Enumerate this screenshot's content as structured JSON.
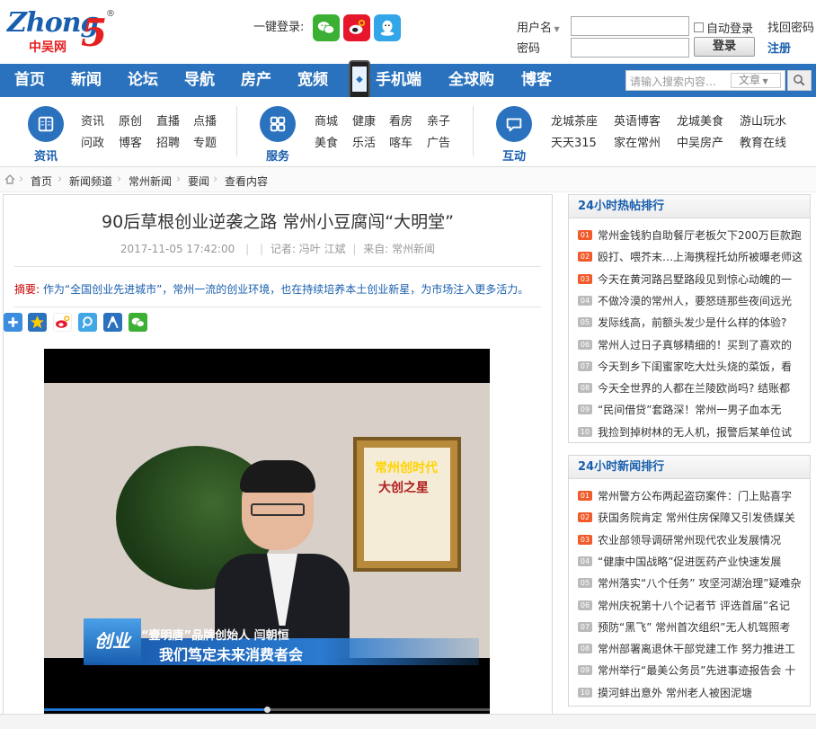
{
  "header": {
    "logo_letters": "Zhong",
    "logo_five": "5",
    "logo_cn": "中吴网",
    "logo_reg": "®",
    "quick_login_label": "一键登录:",
    "username_label": "用户名",
    "password_label": "密码",
    "auto_login_label": "自动登录",
    "login_button": "登录",
    "find_password": "找回密码",
    "register": "注册"
  },
  "nav": {
    "items": [
      "首页",
      "新闻",
      "论坛",
      "导航",
      "房产",
      "宽频",
      "手机端",
      "全球购",
      "博客"
    ],
    "search_placeholder": "请输入搜索内容…",
    "search_category": "文章"
  },
  "subnav": {
    "groups": [
      {
        "label": "资讯",
        "links": [
          "资讯",
          "原创",
          "直播",
          "点播",
          "问政",
          "博客",
          "招聘",
          "专题"
        ]
      },
      {
        "label": "服务",
        "links": [
          "商城",
          "健康",
          "看房",
          "亲子",
          "美食",
          "乐活",
          "喀车",
          "广告"
        ]
      },
      {
        "label": "互动",
        "links": [
          "龙城茶座",
          "英语博客",
          "龙城美食",
          "游山玩水",
          "天天315",
          "家在常州",
          "中吴房产",
          "教育在线"
        ]
      }
    ]
  },
  "breadcrumb": [
    "首页",
    "新闻频道",
    "常州新闻",
    "要闻",
    "查看内容"
  ],
  "article": {
    "title": "90后草根创业逆袭之路 常州小豆腐闯“大明堂”",
    "date": "2017-11-05 17:42:00",
    "reporter": "记者: 冯叶 江斌",
    "source": "来自: 常州新闻",
    "summary_label": "摘要:",
    "summary": " 作为“全国创业先进城市”，常州一流的创业环境，也在持续培养本土创业新星，为市场注入更多活力。"
  },
  "video": {
    "channel_logo": "常州创时代",
    "certificate_text": "大创之星",
    "caption_name": "“壹明唐”品牌创始人  闫朝恒",
    "caption_quote": "我们笃定未来消费者会",
    "badge": "创业",
    "progress": 0.5
  },
  "hot_posts": {
    "title": "24小时热帖排行",
    "items": [
      {
        "rank": "01",
        "text": "常州金钱豹自助餐厅老板欠下200万巨款跑"
      },
      {
        "rank": "02",
        "text": "殴打、喂芥末…上海携程托幼所被曝老师这"
      },
      {
        "rank": "03",
        "text": "今天在黄河路吕墅路段见到惊心动魄的一"
      },
      {
        "rank": "04",
        "text": "不做冷漠的常州人，要怒琏那些夜间远光"
      },
      {
        "rank": "05",
        "text": "发际线高，前额头发少是什么样的体验?"
      },
      {
        "rank": "06",
        "text": "常州人过日子真够精细的！买到了喜欢的"
      },
      {
        "rank": "07",
        "text": "今天到乡下闺蜜家吃大灶头烧的菜饭，看"
      },
      {
        "rank": "08",
        "text": "今天全世界的人都在兰陵欧尚吗? 结账都"
      },
      {
        "rank": "09",
        "text": "“民间借贷”套路深！常州一男子血本无"
      },
      {
        "rank": "10",
        "text": "我捡到掉树林的无人机，报警后某单位试"
      }
    ]
  },
  "news_rank": {
    "title": "24小时新闻排行",
    "items": [
      {
        "rank": "01",
        "text": "常州警方公布两起盗窃案件：门上贴喜字"
      },
      {
        "rank": "02",
        "text": "获国务院肯定 常州住房保障又引发债媒关"
      },
      {
        "rank": "03",
        "text": "农业部领导调研常州现代农业发展情况"
      },
      {
        "rank": "04",
        "text": "“健康中国战略”促进医药产业快速发展"
      },
      {
        "rank": "05",
        "text": "常州落实“八个任务” 攻坚河湖治理”疑难杂"
      },
      {
        "rank": "06",
        "text": "常州庆祝第十八个记者节 评选首届”名记"
      },
      {
        "rank": "07",
        "text": "预防“黑飞” 常州首次组织”无人机驾照考"
      },
      {
        "rank": "08",
        "text": "常州部署离退休干部党建工作 努力推进工"
      },
      {
        "rank": "09",
        "text": "常州举行“最美公务员”先进事迹报告会 十"
      },
      {
        "rank": "10",
        "text": "摸河蚌出意外 常州老人被困泥塘"
      }
    ]
  },
  "colors": {
    "accent": "#2a72bd",
    "hot_rank": "#f15a2b",
    "brand_red": "#e52020"
  }
}
